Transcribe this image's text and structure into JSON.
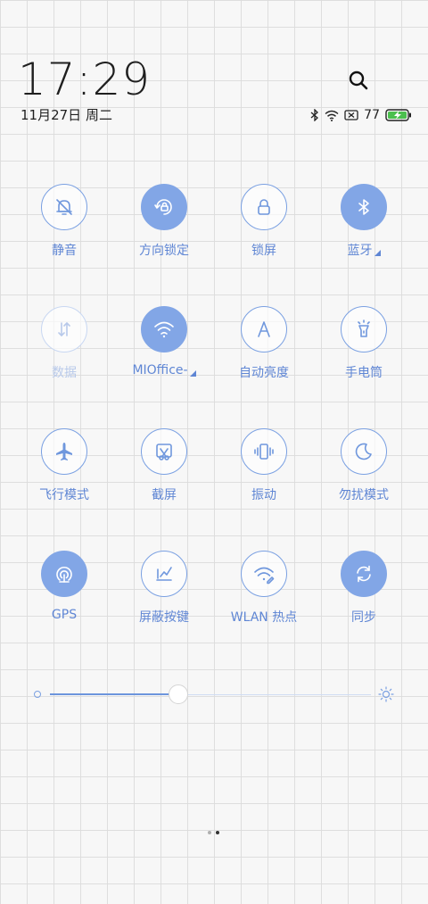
{
  "header": {
    "time": "17:29",
    "date": "11月27日 周二",
    "battery_level": "77"
  },
  "tiles": [
    {
      "label": "静音",
      "icon": "mute-bell-icon",
      "state": "off"
    },
    {
      "label": "方向锁定",
      "icon": "rotation-lock-icon",
      "state": "on"
    },
    {
      "label": "锁屏",
      "icon": "lock-icon",
      "state": "off"
    },
    {
      "label": "蓝牙",
      "icon": "bluetooth-icon",
      "state": "on",
      "has_more": true
    },
    {
      "label": "数据",
      "icon": "mobile-data-icon",
      "state": "disabled"
    },
    {
      "label": "MIOffice-",
      "icon": "wifi-icon",
      "state": "on",
      "has_more": true
    },
    {
      "label": "自动亮度",
      "icon": "auto-brightness-icon",
      "state": "off"
    },
    {
      "label": "手电筒",
      "icon": "flashlight-icon",
      "state": "off"
    },
    {
      "label": "飞行模式",
      "icon": "airplane-icon",
      "state": "off"
    },
    {
      "label": "截屏",
      "icon": "screenshot-icon",
      "state": "off"
    },
    {
      "label": "振动",
      "icon": "vibrate-icon",
      "state": "off"
    },
    {
      "label": "勿扰模式",
      "icon": "moon-icon",
      "state": "off"
    },
    {
      "label": "GPS",
      "icon": "gps-icon",
      "state": "on"
    },
    {
      "label": "屏蔽按键",
      "icon": "block-keys-icon",
      "state": "off"
    },
    {
      "label": "WLAN 热点",
      "icon": "hotspot-icon",
      "state": "off"
    },
    {
      "label": "同步",
      "icon": "sync-icon",
      "state": "on"
    }
  ],
  "brightness": {
    "level": 0.4
  },
  "pager": {
    "pages": 2,
    "current": 2
  },
  "colors": {
    "accent": "#82a6e6",
    "label": "#5f86d4",
    "disabled": "#b8c9ea"
  }
}
